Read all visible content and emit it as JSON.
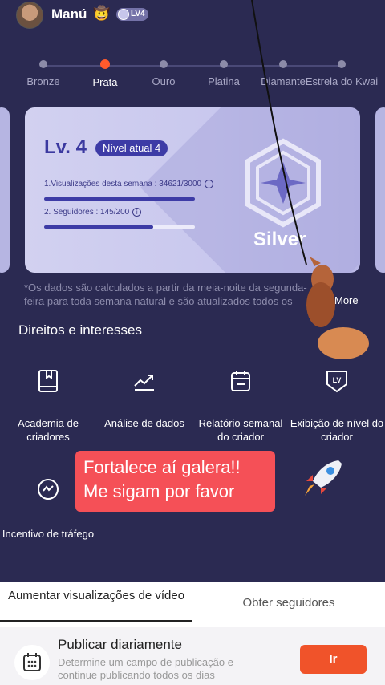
{
  "header": {
    "username": "Manú",
    "username_emoji": "🤠",
    "level_badge": "LV4"
  },
  "tiers": [
    {
      "label": "Bronze",
      "active": false
    },
    {
      "label": "Prata",
      "active": true
    },
    {
      "label": "Ouro",
      "active": false
    },
    {
      "label": "Platina",
      "active": false
    },
    {
      "label": "Diamante",
      "active": false
    },
    {
      "label": "Estrela do Kwai",
      "active": false
    }
  ],
  "card": {
    "level_title": "Lv. 4",
    "current_level_pill": "Nível atual 4",
    "metrics": [
      {
        "label": "1.Visualizações desta semana : 34621/3000",
        "progress": 1.0
      },
      {
        "label": "2. Seguidores : 145/200",
        "progress": 0.725
      }
    ],
    "tier_name": "Silver"
  },
  "note": "*Os dados são calculados a partir da meia-noite da segunda-feira para toda semana natural e são atualizados todos os",
  "more_link": "More",
  "rights": {
    "title": "Direitos e interesses",
    "items": [
      {
        "label": "Academia de criadores",
        "icon": "book-icon"
      },
      {
        "label": "Análise de dados",
        "icon": "trend-chart-icon"
      },
      {
        "label": "Relatório semanal do criador",
        "icon": "calendar-report-icon"
      },
      {
        "label": "Exibição de nível do criador",
        "icon": "lv-badge-icon"
      },
      {
        "label": "Incentivo de tráfego",
        "icon": "traffic-boost-icon"
      }
    ]
  },
  "promo": {
    "line1": "Fortalece aí galera!!",
    "line2": "Me sigam por favor"
  },
  "sheet": {
    "tabs": [
      "Aumentar visualizações de vídeo",
      "Obter seguidores"
    ],
    "task": {
      "title": "Publicar diariamente",
      "description": "Determine um campo de publicação e continue publicando todos os dias",
      "button": "Ir"
    }
  },
  "colors": {
    "background": "#2b2a52",
    "accent": "#ff5a2c",
    "card": "#c9c8ee",
    "promo": "#f55057",
    "button": "#f0532a"
  }
}
